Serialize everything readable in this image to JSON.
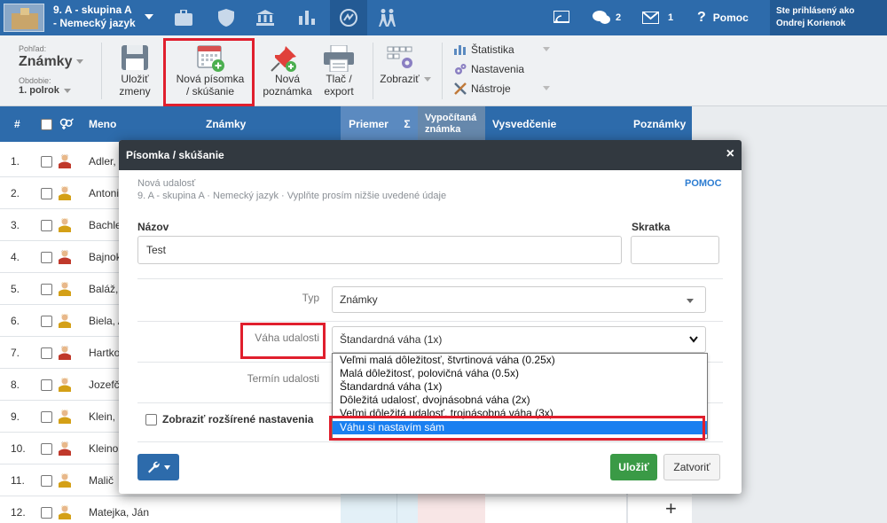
{
  "topbar": {
    "class_line1": "9. A - skupina A",
    "class_line2": "- Nemecký jazyk",
    "messages_count": "2",
    "mail_count": "1",
    "help_label": "Pomoc",
    "user_line1": "Ste prihlásený ako",
    "user_line2": "Ondrej Korienok",
    "colors": {
      "bar": "#2d6bab",
      "active": "#235a94"
    }
  },
  "ribbon": {
    "view_label": "Pohľad:",
    "view_value": "Známky",
    "period_label": "Obdobie:",
    "period_value": "1. polrok",
    "save_line1": "Uložiť",
    "save_line2": "zmeny",
    "new_test_line1": "Nová písomka",
    "new_test_line2": "/ skúšanie",
    "new_note_line1": "Nová",
    "new_note_line2": "poznámka",
    "print_line1": "Tlač /",
    "print_line2": "export",
    "show_label": "Zobraziť",
    "menu_stats": "Štatistika",
    "menu_settings": "Nastavenia",
    "menu_tools": "Nástroje"
  },
  "grid": {
    "headers": {
      "num": "#",
      "name": "Meno",
      "grades": "Známky",
      "average": "Priemer",
      "sum": "Σ",
      "computed_line1": "Vypočítaná",
      "computed_line2": "známka",
      "certificate": "Vysvedčenie",
      "notes": "Poznámky"
    },
    "rows": [
      {
        "num": "1.",
        "name": "Adler, J"
      },
      {
        "num": "2.",
        "name": "Antoni"
      },
      {
        "num": "3.",
        "name": "Bachle"
      },
      {
        "num": "4.",
        "name": "Bajnok"
      },
      {
        "num": "5.",
        "name": "Baláž,"
      },
      {
        "num": "6.",
        "name": "Biela, A"
      },
      {
        "num": "7.",
        "name": "Hartko"
      },
      {
        "num": "8.",
        "name": "Jozefč"
      },
      {
        "num": "9.",
        "name": "Klein,"
      },
      {
        "num": "10.",
        "name": "Kleino"
      },
      {
        "num": "11.",
        "name": "Malič"
      },
      {
        "num": "12.",
        "name": "Matejka, Ján"
      }
    ],
    "add_symbol": "+"
  },
  "modal": {
    "title": "Písomka / skúšanie",
    "close": "×",
    "subtitle1": "Nová udalosť",
    "subtitle2": "9. A - skupina A · Nemecký jazyk · Vyplňte prosím nižšie uvedené údaje",
    "help": "POMOC",
    "name_label": "Názov",
    "name_value": "Test",
    "short_label": "Skratka",
    "short_value": "",
    "type_label": "Typ",
    "type_value": "Známky",
    "weight_label": "Váha udalosti",
    "weight_value": "Štandardná váha (1x)",
    "date_label": "Termín udalosti",
    "weight_options": [
      "Veľmi malá dôležitosť, štvrtinová váha (0.25x)",
      "Malá dôležitosť, polovičná váha (0.5x)",
      "Štandardná váha (1x)",
      "Dôležitá udalosť, dvojnásobná váha (2x)",
      "Veľmi dôležitá udalosť, trojnásobná váha (3x)",
      "Váhu si nastavím sám"
    ],
    "selected_option_index": 5,
    "advanced_label": "Zobraziť rozšírené nastavenia",
    "save_label": "Uložiť",
    "cancel_label": "Zatvoriť",
    "colors": {
      "header": "#323940",
      "save": "#3a9a46",
      "highlight": "#e01f2d",
      "option_selected": "#1a7ff0"
    }
  }
}
